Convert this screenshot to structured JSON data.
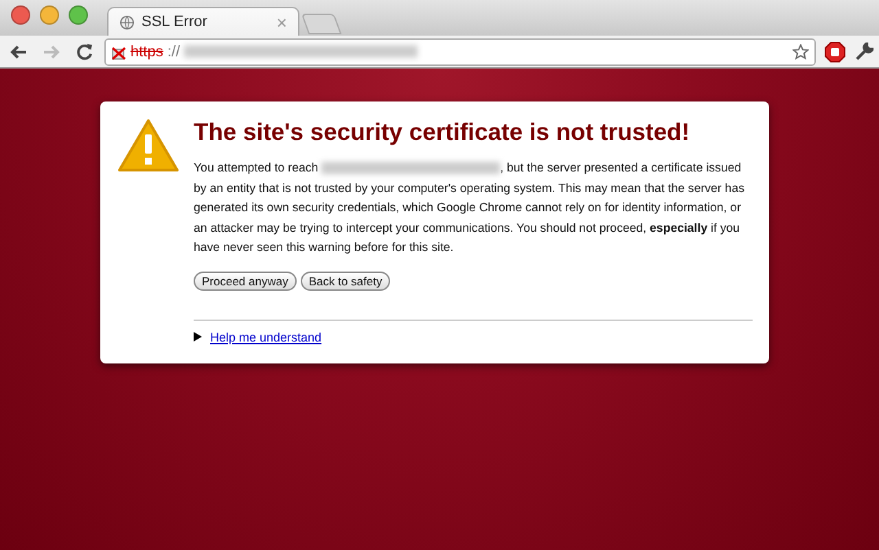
{
  "tab": {
    "title": "SSL Error",
    "close": "×"
  },
  "address_bar": {
    "scheme": "https",
    "separator": "://"
  },
  "error": {
    "title": "The site's security certificate is not trusted!",
    "paragraph_before": "You attempted to reach",
    "paragraph_after": ", but the server presented a certificate issued by an entity that is not trusted by your computer's operating system. This may mean that the server has generated its own security credentials, which Google Chrome cannot rely on for identity information, or an attacker may be trying to intercept your communications. You should not proceed, **especially** if you have never seen this warning before for this site.",
    "buttons": [
      "Proceed anyway",
      "Back to safety"
    ],
    "help_link": {
      "label": "Help me understand",
      "expanded": false
    }
  }
}
